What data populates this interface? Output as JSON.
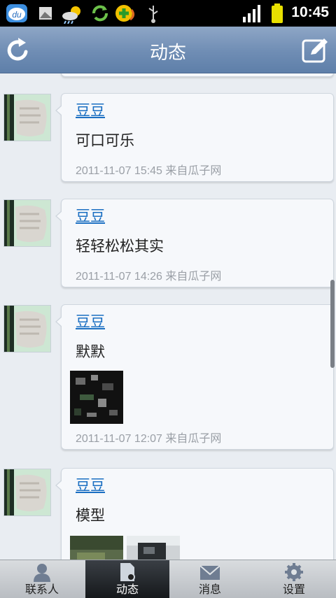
{
  "status": {
    "time": "10:45"
  },
  "header": {
    "title": "动态"
  },
  "feed": {
    "items": [
      {
        "name": "豆豆",
        "text": "可口可乐",
        "meta": "2011-11-07 15:45 来自瓜子网"
      },
      {
        "name": "豆豆",
        "text": "轻轻松松其实",
        "meta": "2011-11-07 14:26 来自瓜子网"
      },
      {
        "name": "豆豆",
        "text": "默默",
        "meta": "2011-11-07 12:07 来自瓜子网"
      },
      {
        "name": "豆豆",
        "text": "模型"
      }
    ]
  },
  "tabs": [
    {
      "label": "联系人"
    },
    {
      "label": "动态"
    },
    {
      "label": "消息"
    },
    {
      "label": "设置"
    }
  ]
}
